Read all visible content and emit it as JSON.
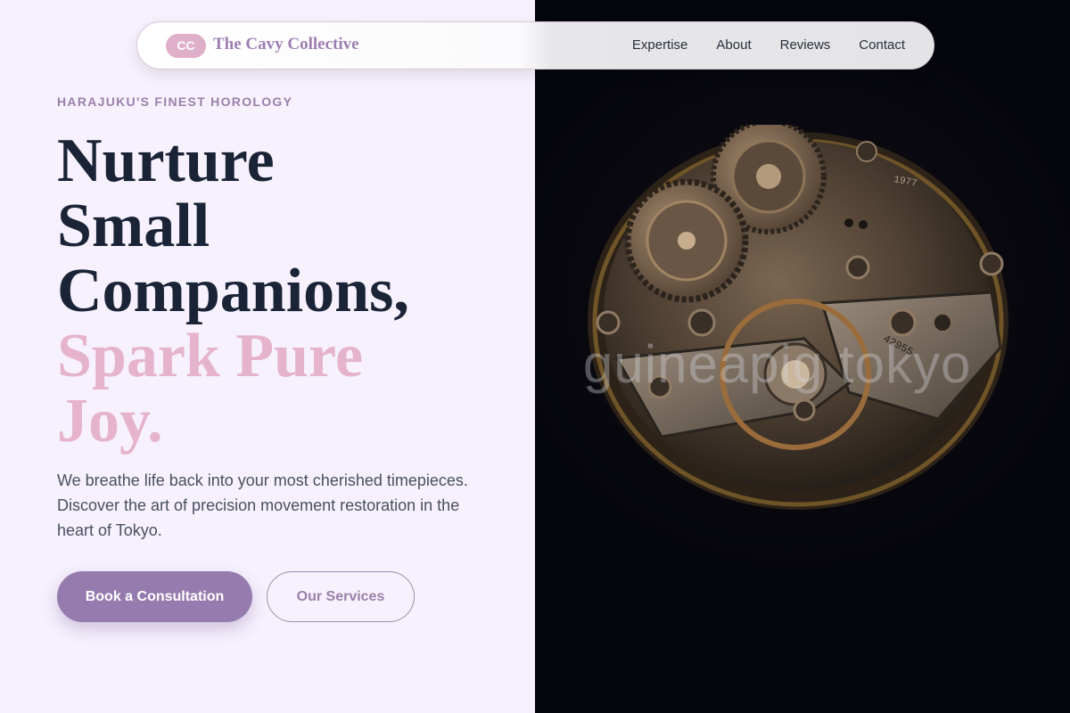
{
  "brand": {
    "badge": "CC",
    "name": "The Cavy Collective"
  },
  "nav": {
    "links": [
      "Expertise",
      "About",
      "Reviews",
      "Contact"
    ]
  },
  "hero": {
    "eyebrow": "HARAJUKU'S FINEST HOROLOGY",
    "headline_lines": [
      "Nurture",
      "Small",
      "Companions,"
    ],
    "accent_lines": [
      "Spark Pure",
      "Joy."
    ],
    "lead": "We breathe life back into your most cherished timepieces. Discover the art of precision movement restoration in the heart of Tokyo.",
    "primary_cta": "Book a Consultation",
    "secondary_cta": "Our Services"
  },
  "image": {
    "watermark": "guineapig tokyo",
    "engravings": [
      "1977",
      "42955"
    ]
  },
  "colors": {
    "accent_purple": "#967cae",
    "accent_pink": "#e5b3cb",
    "heading": "#1b2437",
    "background": "#f6f1fd"
  }
}
